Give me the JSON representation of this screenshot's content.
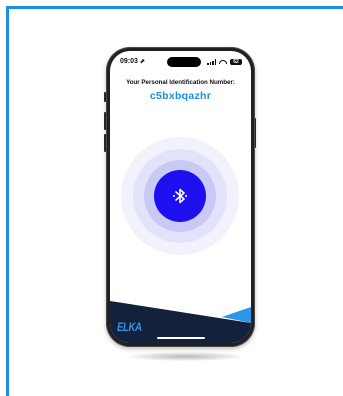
{
  "status_bar": {
    "time": "09:03",
    "location_symbol": "⬈",
    "battery": "62"
  },
  "pin_screen": {
    "label": "Your Personal Identification Number:",
    "pin": "c5bxbqazhr"
  },
  "brand": {
    "logo_text": "ELKA"
  },
  "colors": {
    "frame": "#1e90e0",
    "pin_text": "#1a8fe0",
    "bluetooth_button": "#1e0ff0",
    "footer_dark": "#14213d",
    "footer_accent": "#2b95e8"
  },
  "icons": {
    "center_button": "bluetooth-icon"
  }
}
